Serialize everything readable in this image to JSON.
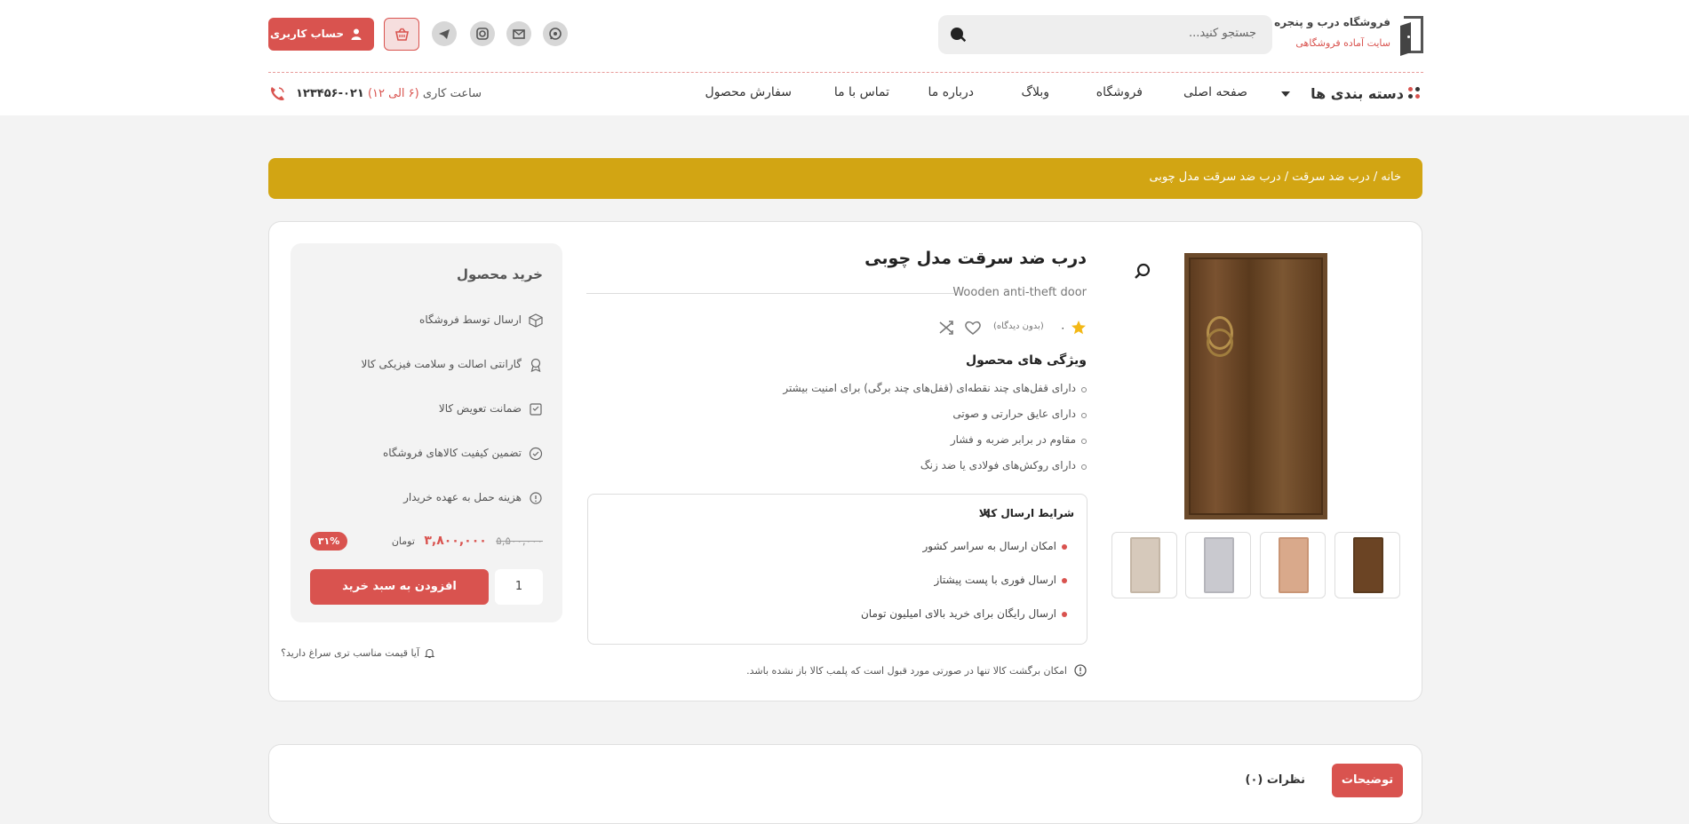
{
  "header": {
    "brand_title": "فروشگاه درب و پنجره",
    "brand_subtitle": "سایت آماده فروشگاهی",
    "search_placeholder": "جستجو کنید...",
    "account_label": "حساب کاربری",
    "social_icons": [
      "whatsapp-icon",
      "email-icon",
      "instagram-icon",
      "telegram-icon"
    ]
  },
  "nav": {
    "categories_label": "دسته بندی ها",
    "items": [
      "صفحه اصلی",
      "فروشگاه",
      "وبلاگ",
      "درباره ما",
      "تماس با ما",
      "سفارش محصول"
    ],
    "hours_label": "ساعت کاری",
    "hours_value": "(۶ الی ۱۲)",
    "phone": "۰۲۱-۱۲۳۴۵۶"
  },
  "breadcrumb": "خانه / درب ضد سرقت / درب ضد سرقت مدل چوبی",
  "product": {
    "title": "درب ضد سرقت مدل چوبی",
    "title_en": "Wooden anti-theft door",
    "rating": "۰",
    "review_count": "(بدون دیدگاه)",
    "features_title": "ویژگی های محصول",
    "features": [
      "دارای قفل‌های چند نقطه‌ای (قفل‌های چند برگی) برای امنیت بیشتر",
      "دارای عایق حرارتی و صوتی",
      "مقاوم در برابر ضربه و فشار",
      "دارای روکش‌های فولادی یا ضد زنگ"
    ],
    "shipping_title": "شرایط ارسال کالا",
    "shipping_items": [
      "امکان ارسال به سراسر کشور",
      "ارسال فوری با پست پیشتاز",
      "ارسال رایگان برای خرید بالای امیلیون تومان"
    ],
    "return_note": "امکان برگشت کالا تنها در صورتی مورد قبول است که پلمب کالا باز نشده باشد.",
    "thumbnail_colors": [
      "#6b4424",
      "#d9a98b",
      "#c9c9cf",
      "#d6c9bb"
    ]
  },
  "buy": {
    "title": "خرید محصول",
    "features": [
      "ارسال توسط فروشگاه",
      "گارانتی اصالت و سلامت فیزیکی کالا",
      "ضمانت تعویض کالا",
      "تضمین کیفیت کالاهای فروشگاه",
      "هزینه حمل به عهده خریدار"
    ],
    "discount": "۳۱%",
    "price_old": "۵,۵۰۰,۰۰۰",
    "price_new": "۳,۸۰۰,۰۰۰",
    "currency": "تومان",
    "quantity": "1",
    "add_to_cart": "افزودن به سبد خرید",
    "cheaper_question": "آیا قیمت مناسب تری سراغ دارید؟"
  },
  "tabs": {
    "description": "توضیحات",
    "reviews": "نظرات (۰)"
  },
  "colors": {
    "accent": "#d9534f",
    "breadcrumb_bg": "#d2a513"
  }
}
